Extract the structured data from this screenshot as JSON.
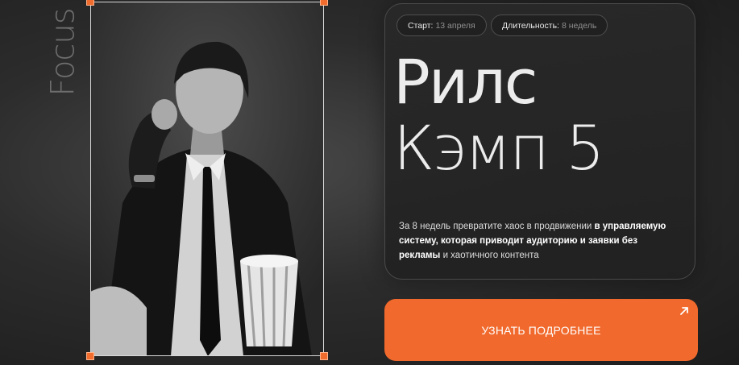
{
  "brand": {
    "vertical_word": "Focus"
  },
  "course": {
    "start_label": "Старт:",
    "start_value": "13 апреля",
    "duration_label": "Длительность:",
    "duration_value": "8 недель",
    "title_line1": "Рилс",
    "title_line2": "Кэмп 5",
    "description": {
      "part1": "За 8 недель превратите хаос в продвижении",
      "bold": "в управляемую систему, которая приводит аудиторию и заявки без рекламы",
      "part2": "и хаотичного контента"
    }
  },
  "cta": {
    "label": "УЗНАТЬ ПОДРОБНЕЕ",
    "icon": "arrow-up-right-icon"
  },
  "colors": {
    "accent": "#f1692c",
    "background": "#2a2a2a",
    "card_border": "#4a4a4a"
  }
}
